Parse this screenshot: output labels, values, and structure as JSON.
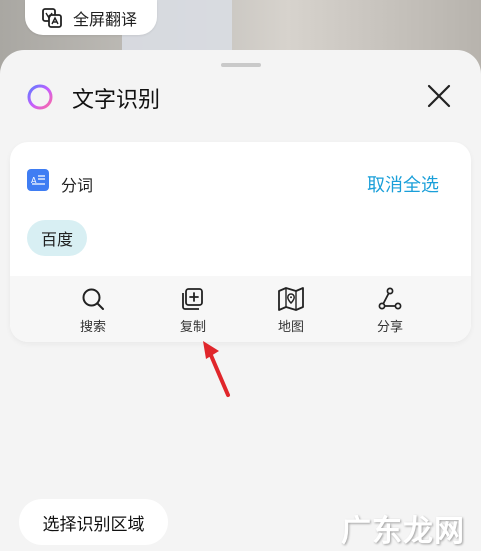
{
  "top": {
    "translate_label": "全屏翻译"
  },
  "sheet": {
    "title": "文字识别",
    "segment_label": "分词",
    "deselect_all": "取消全选",
    "chip_text": "百度"
  },
  "actions": [
    {
      "label": "搜索",
      "icon": "search-icon"
    },
    {
      "label": "复制",
      "icon": "copy-icon"
    },
    {
      "label": "地图",
      "icon": "map-icon"
    },
    {
      "label": "分享",
      "icon": "share-icon"
    }
  ],
  "footer": {
    "select_region": "选择识别区域"
  },
  "watermark": "广东龙网",
  "colors": {
    "accent": "#1a9fd9",
    "chip_bg": "#d8eff3",
    "arrow": "#e0262b"
  }
}
